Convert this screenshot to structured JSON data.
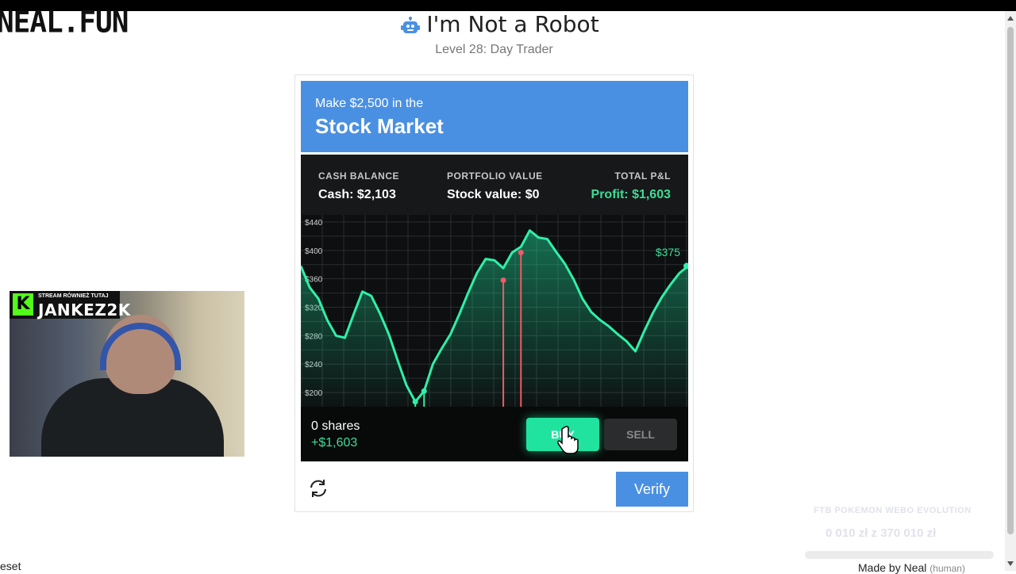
{
  "site": {
    "logo": "NEAL.FUN"
  },
  "header": {
    "title": "I'm Not a Robot",
    "subtitle": "Level 28: Day Trader"
  },
  "captcha": {
    "task_small": "Make $2,500 in the",
    "task_big": "Stock Market",
    "stats": {
      "cash_label": "CASH BALANCE",
      "cash_value": "Cash: $2,103",
      "portfolio_label": "PORTFOLIO VALUE",
      "portfolio_value": "Stock value: $0",
      "pl_label": "TOTAL P&L",
      "pl_value": "Profit: $1,603"
    },
    "chart_data": {
      "type": "line",
      "y_ticks": [
        "$440",
        "$400",
        "$360",
        "$320",
        "$280",
        "$240",
        "$200"
      ],
      "ylim": [
        180,
        450
      ],
      "current_price_label": "$375",
      "x": [
        0,
        1,
        2,
        3,
        4,
        5,
        6,
        7,
        8,
        9,
        10,
        11,
        12,
        13,
        14,
        15,
        16,
        17,
        18,
        19,
        20,
        21,
        22,
        23,
        24,
        25,
        26,
        27,
        28,
        29,
        30,
        31,
        32,
        33,
        34,
        35,
        36,
        37,
        38,
        39,
        40,
        41,
        42,
        43,
        44,
        45,
        46,
        47,
        48,
        49,
        50,
        51,
        52,
        53,
        54,
        55,
        56,
        57,
        58,
        59,
        60
      ],
      "y": [
        378,
        348,
        332,
        302,
        280,
        277,
        310,
        342,
        336,
        311,
        282,
        245,
        210,
        187,
        202,
        240,
        262,
        282,
        310,
        340,
        368,
        388,
        386,
        375,
        397,
        405,
        428,
        418,
        416,
        398,
        381,
        359,
        332,
        313,
        302,
        293,
        282,
        272,
        258,
        286,
        312,
        334,
        352,
        368,
        378
      ],
      "events": [
        {
          "type": "buy",
          "index": 13,
          "price": 187
        },
        {
          "type": "buy",
          "index": 14,
          "price": 202
        },
        {
          "type": "sell",
          "index": 23,
          "price": 358
        },
        {
          "type": "sell",
          "index": 25,
          "price": 397
        }
      ],
      "grid": true
    },
    "position": {
      "shares": "0 shares",
      "pl": "+$1,603"
    },
    "buy_label": "BUY",
    "sell_label": "SELL",
    "verify_label": "Verify"
  },
  "stream": {
    "tag_small": "STREAM RÓWNIEŻ TUTAJ",
    "tag_name": "JANKEZ2K",
    "k": "K"
  },
  "overlay": {
    "line1": "FTB POKEMON WEBO EVOLUTION",
    "line2": "0 010 zł z 370 010 zł"
  },
  "footer": {
    "reset": "eset",
    "made_by": "Made by Neal",
    "human": "(human)"
  }
}
